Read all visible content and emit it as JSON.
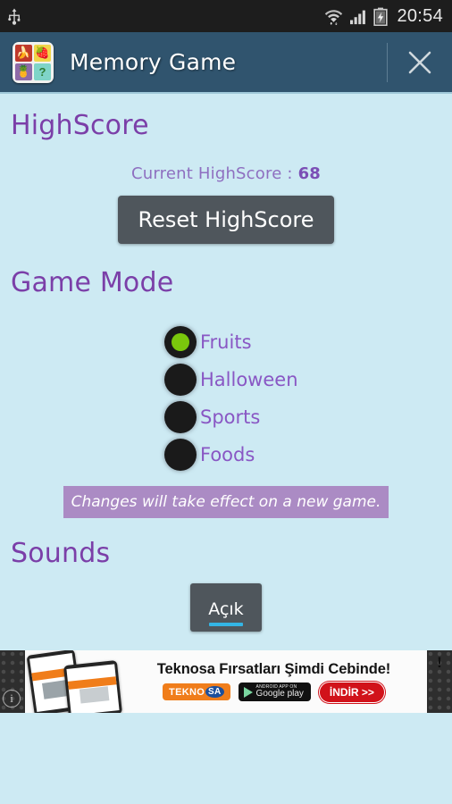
{
  "status_bar": {
    "usb_icon": "usb-icon",
    "wifi_icon": "wifi-icon",
    "signal_icon": "cellular-signal-icon",
    "battery_icon": "battery-charging-icon",
    "clock": "20:54"
  },
  "title_bar": {
    "app_title": "Memory Game",
    "app_icon": {
      "cell1": "🍌",
      "cell2": "🍓",
      "cell3": "🍍",
      "cell4": "?"
    },
    "close_label": "✕"
  },
  "highscore": {
    "heading": "HighScore",
    "current_label": "Current HighScore : ",
    "current_value": "68",
    "reset_button": "Reset HighScore"
  },
  "game_mode": {
    "heading": "Game Mode",
    "options": [
      {
        "label": "Fruits",
        "selected": true
      },
      {
        "label": "Halloween",
        "selected": false
      },
      {
        "label": "Sports",
        "selected": false
      },
      {
        "label": "Foods",
        "selected": false
      }
    ],
    "notice": "Changes will take effect on a new game."
  },
  "sounds": {
    "heading": "Sounds",
    "toggle_label": "Açık"
  },
  "ad": {
    "headline": "Teknosa Fırsatları Şimdi Cebinde!",
    "badge_teknosa_a": "TEKNO",
    "badge_teknosa_b": "SA",
    "badge_gplay_small": "ANDROID APP ON",
    "badge_gplay_big": "Google play",
    "badge_indir": "İNDİR >>",
    "info_badge": "i",
    "exclaim_badge": "!"
  },
  "colors": {
    "background": "#cdeaf3",
    "title_bar": "#30546e",
    "heading_purple": "#7b3fa8",
    "label_purple": "#8957c4",
    "button_dark": "#4f565c",
    "radio_selected_green": "#7ac70c",
    "notice_purple": "#ab8bc4",
    "toggle_indicator_blue": "#33b5e5",
    "status_bar": "#1d1d1d"
  }
}
